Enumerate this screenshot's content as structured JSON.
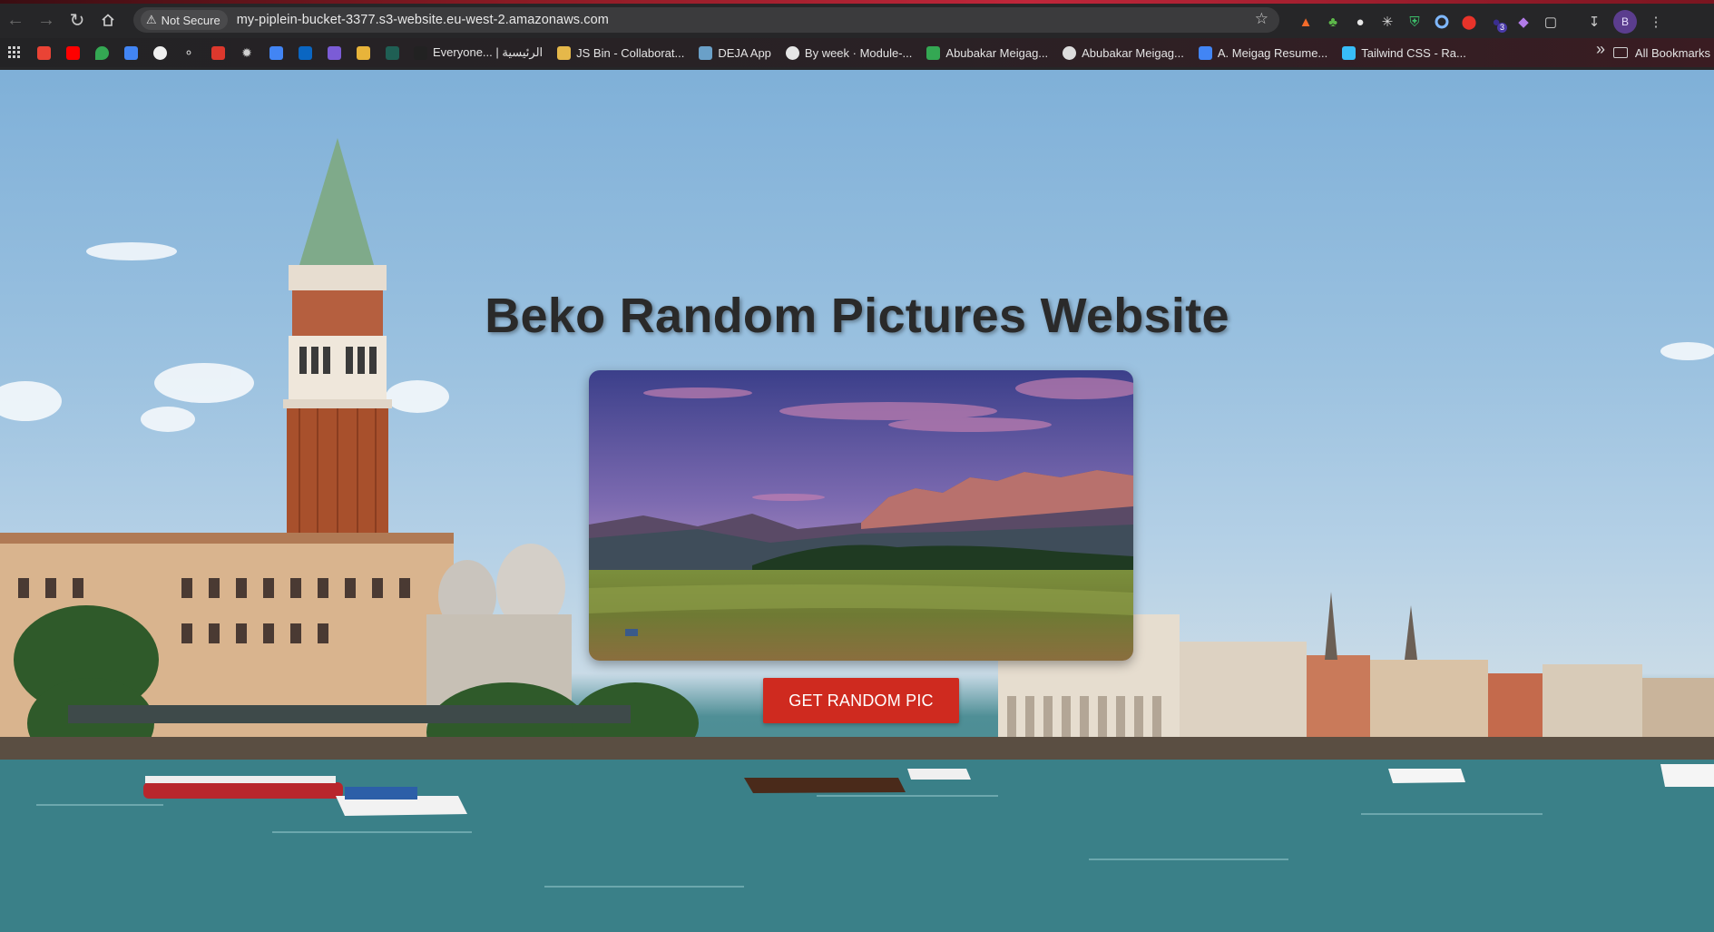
{
  "browser": {
    "security_label": "Not Secure",
    "url": "my-piplein-bucket-3377.s3-website.eu-west-2.amazonaws.com",
    "profile_initial": "B",
    "extension_badge": "3",
    "bookmarks": [
      {
        "label": "Everyone... | الرئيسية",
        "color": "#222222"
      },
      {
        "label": "JS Bin - Collaborat...",
        "color": "#e5b84a"
      },
      {
        "label": "DEJA App",
        "color": "#6aa0c8"
      },
      {
        "label": "By week · Module-...",
        "color": "#e6e6e6"
      },
      {
        "label": "Abubakar Meigag...",
        "color": "#34a853"
      },
      {
        "label": "Abubakar Meigag...",
        "color": "#dddddd"
      },
      {
        "label": "A. Meigag Resume...",
        "color": "#4285f4"
      },
      {
        "label": "Tailwind CSS - Ra...",
        "color": "#38bdf8"
      }
    ],
    "all_bookmarks_label": "All Bookmarks"
  },
  "page": {
    "title": "Beko Random Pictures Website",
    "button_label": "GET RANDOM PIC"
  },
  "colors": {
    "button": "#cf2a1f",
    "title": "#2a2a2a"
  }
}
